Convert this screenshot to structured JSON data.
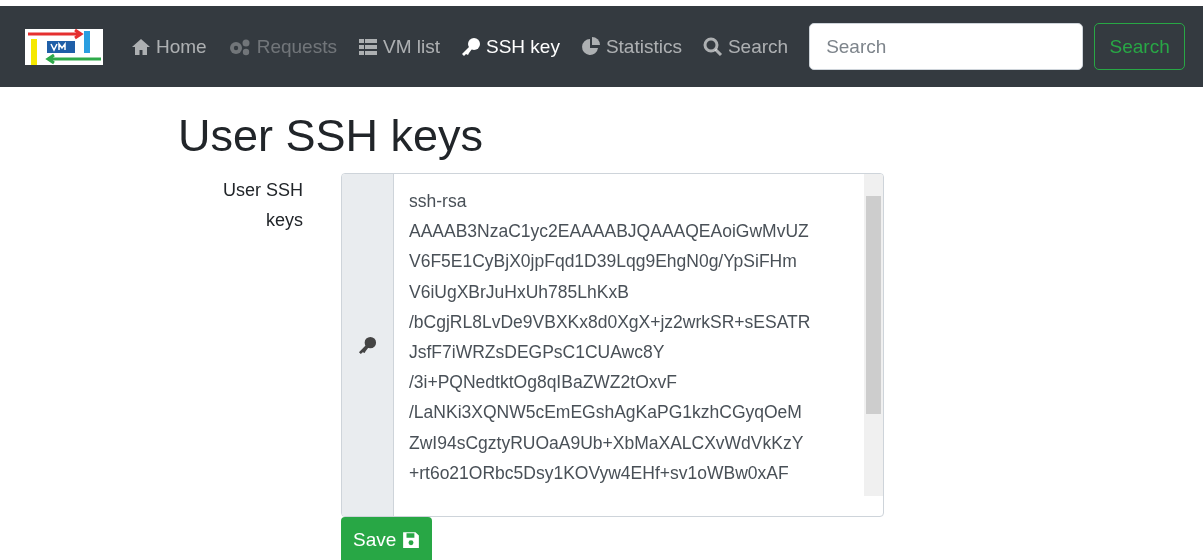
{
  "navbar": {
    "items": [
      {
        "label": "Home",
        "selected": false,
        "disabled": false
      },
      {
        "label": "Requests",
        "selected": false,
        "disabled": true
      },
      {
        "label": "VM list",
        "selected": false,
        "disabled": false
      },
      {
        "label": "SSH key",
        "selected": true,
        "disabled": false
      },
      {
        "label": "Statistics",
        "selected": false,
        "disabled": false
      },
      {
        "label": "Search",
        "selected": false,
        "disabled": false
      }
    ],
    "search": {
      "placeholder": "Search"
    },
    "search_button": "Search"
  },
  "page_title": "User SSH keys",
  "form": {
    "label": "User SSH keys",
    "key_lines": [
      "ssh-rsa",
      "AAAAB3NzaC1yc2EAAAABJQAAAQEAoiGwMvUZ",
      "V6F5E1CyBjX0jpFqd1D39Lqg9EhgN0g/YpSiFHm",
      "V6iUgXBrJuHxUh785LhKxB",
      "/bCgjRL8LvDe9VBXKx8d0XgX+jz2wrkSR+sESATR",
      "JsfF7iWRZsDEGPsC1CUAwc8Y",
      "/3i+PQNedtktOg8qIBaZWZ2tOxvF",
      "/LaNKi3XQNW5cEmEGshAgKaPG1kzhCGyqOeM",
      "ZwI94sCgztyRUOaA9Ub+XbMaXALCXvWdVkKzY",
      "+rt6o21ORbc5Dsy1KOVyw4EHf+sv1oWBw0xAF"
    ],
    "save_button": "Save"
  }
}
